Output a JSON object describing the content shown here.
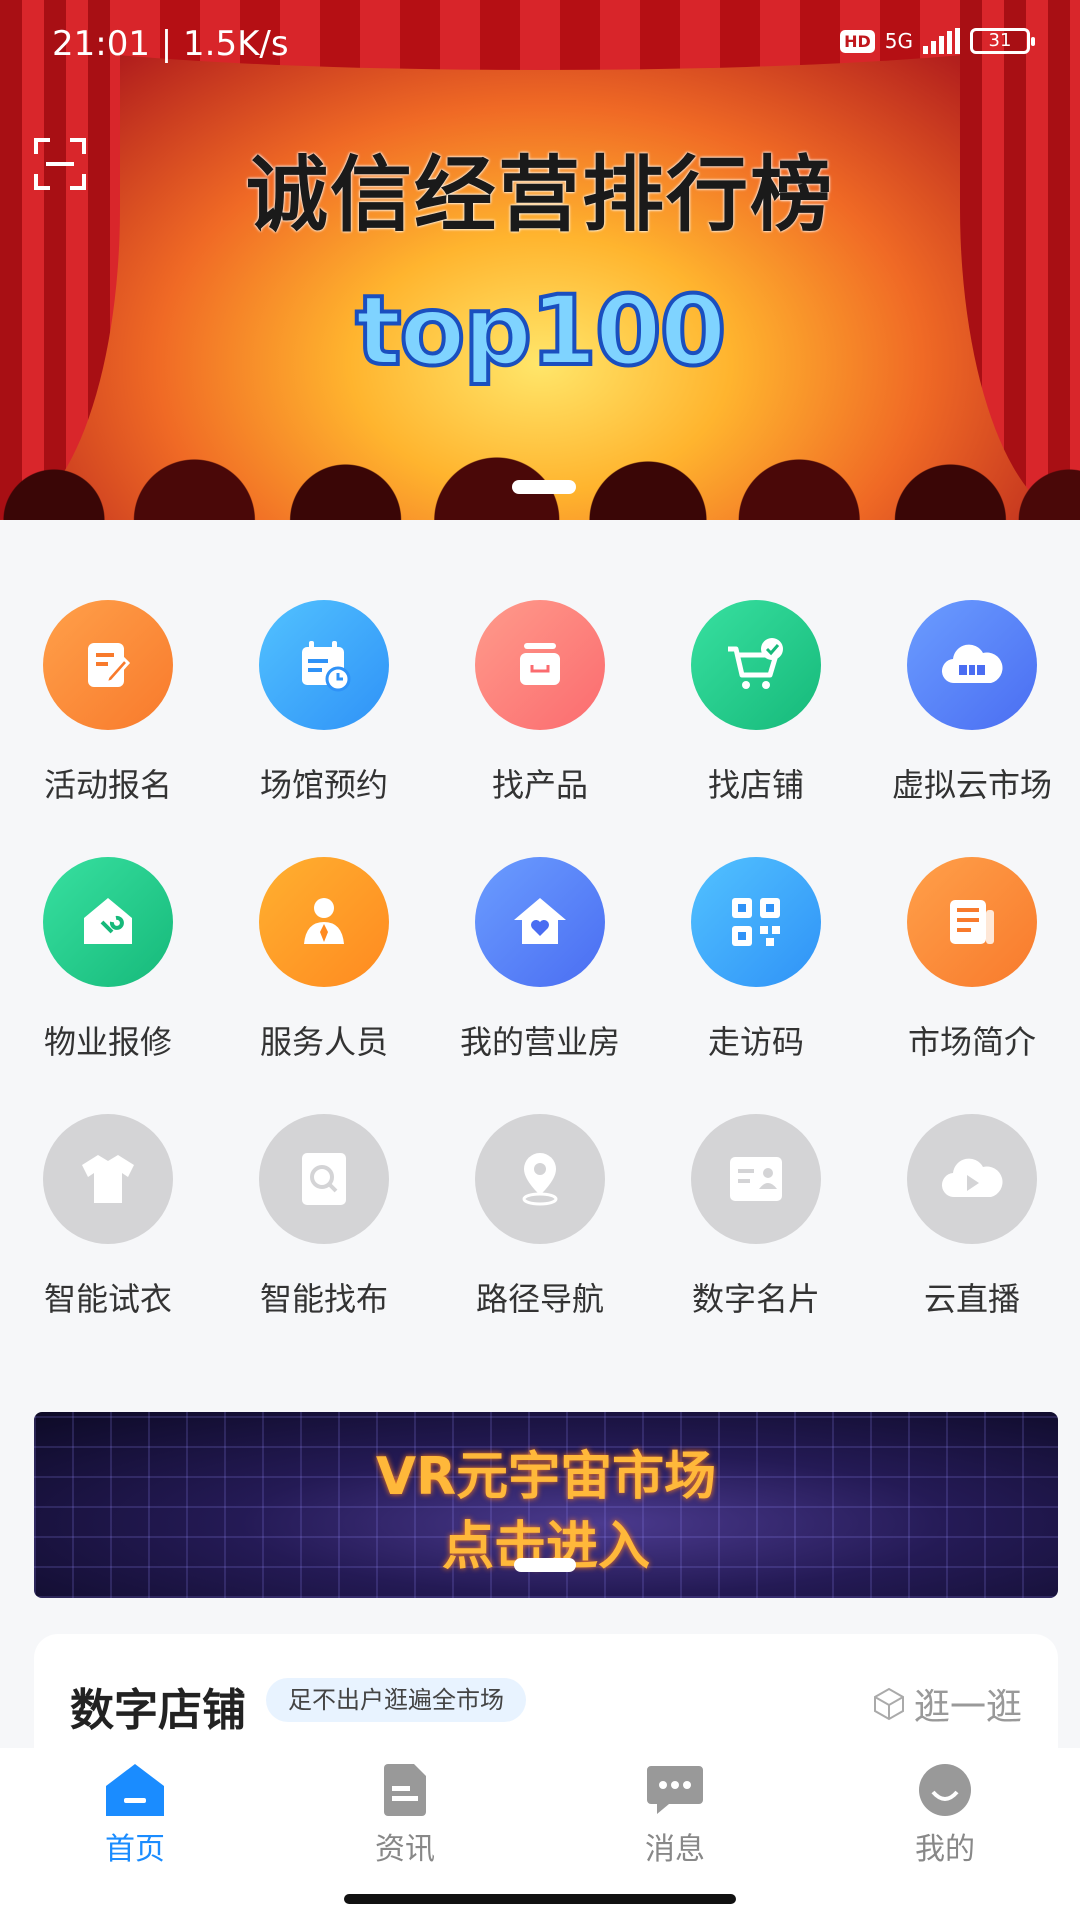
{
  "status_bar": {
    "time_speed": "21:01 | 1.5K/s",
    "hd": "HD",
    "network": "5G",
    "battery": "31"
  },
  "banner": {
    "title": "诚信经营排行榜",
    "subtitle": "top100"
  },
  "grid": [
    {
      "label": "活动报名",
      "icon": "edit-icon",
      "color": "#f87a2c"
    },
    {
      "label": "场馆预约",
      "icon": "calendar-icon",
      "color": "#2f92f7"
    },
    {
      "label": "找产品",
      "icon": "box-icon",
      "color": "#fb6b6f"
    },
    {
      "label": "找店铺",
      "icon": "cart-icon",
      "color": "#16b97a"
    },
    {
      "label": "虚拟云市场",
      "icon": "cloud-icon",
      "color": "#4a6df2"
    },
    {
      "label": "物业报修",
      "icon": "house-wrench-icon",
      "color": "#16b97a"
    },
    {
      "label": "服务人员",
      "icon": "person-icon",
      "color": "#ff8a20"
    },
    {
      "label": "我的营业房",
      "icon": "house-heart-icon",
      "color": "#4a6df2"
    },
    {
      "label": "走访码",
      "icon": "qr-code-icon",
      "color": "#2f92f7"
    },
    {
      "label": "市场简介",
      "icon": "document-icon",
      "color": "#f87a2c"
    },
    {
      "label": "智能试衣",
      "icon": "shirt-icon",
      "color": "#d4d4d6"
    },
    {
      "label": "智能找布",
      "icon": "fabric-search-icon",
      "color": "#d4d4d6"
    },
    {
      "label": "路径导航",
      "icon": "location-pin-icon",
      "color": "#d4d4d6"
    },
    {
      "label": "数字名片",
      "icon": "id-card-icon",
      "color": "#d4d4d6"
    },
    {
      "label": "云直播",
      "icon": "cloud-play-icon",
      "color": "#d4d4d6"
    }
  ],
  "vr_banner": {
    "line1": "VR元宇宙市场",
    "line2": "点击进入"
  },
  "store_card": {
    "title": "数字店铺",
    "tag": "足不出户逛遍全市场",
    "more": "逛一逛"
  },
  "tabbar": [
    {
      "label": "首页",
      "icon": "home-icon",
      "active": true
    },
    {
      "label": "资讯",
      "icon": "news-icon",
      "active": false
    },
    {
      "label": "消息",
      "icon": "message-icon",
      "active": false
    },
    {
      "label": "我的",
      "icon": "profile-icon",
      "active": false
    }
  ]
}
